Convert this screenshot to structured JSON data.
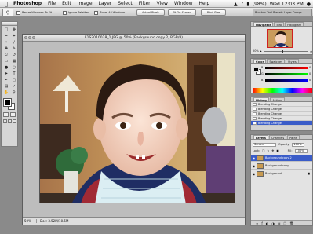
{
  "menubar": {
    "apple": "",
    "items": [
      "Photoshop",
      "File",
      "Edit",
      "Image",
      "Layer",
      "Select",
      "Filter",
      "View",
      "Window",
      "Help"
    ],
    "battery": "(98%)",
    "time": "Wed 12:03 PM",
    "battery_icon": "battery-icon",
    "volume_icon": "volume-icon",
    "search_icon": "spotlight-search-icon"
  },
  "options_bar": {
    "resize_windows": "Resize Windows To Fit",
    "ignore_palettes": "Ignore Palettes",
    "zoom_all": "Zoom All Windows",
    "actual_pixels": "Actual Pixels",
    "fit_on_screen": "Fit On Screen",
    "print_size": "Print Size",
    "palette_well": "Brushes  Tool Presets  Layer Comps"
  },
  "document": {
    "title": "F1S2010028_1.JPG @ 50% (Background copy 2, RGB/8)",
    "zoom": "50%",
    "doc_size": "Doc: 3.52M/10.5M"
  },
  "navigator": {
    "tabs": [
      "Navigator",
      "Info",
      "Histogram"
    ],
    "zoom": "50%"
  },
  "color_panel": {
    "tabs": [
      "Color",
      "Swatches",
      "Styles"
    ],
    "channels": [
      {
        "label": "R",
        "value": "0"
      },
      {
        "label": "G",
        "value": "0"
      },
      {
        "label": "B",
        "value": "0"
      }
    ]
  },
  "history": {
    "tabs": [
      "History",
      "Actions"
    ],
    "items": [
      "Blending Change",
      "Blending Change",
      "Blending Change",
      "Blending Change",
      "Blending Change"
    ],
    "selected_index": 4
  },
  "layers": {
    "tabs": [
      "Layers",
      "Channels",
      "Paths"
    ],
    "blend_mode": "Screen",
    "opacity_label": "Opacity:",
    "opacity": "100%",
    "lock_label": "Lock:",
    "fill_label": "Fill:",
    "fill": "100%",
    "items": [
      {
        "name": "Background copy 2",
        "selected": true
      },
      {
        "name": "Background copy",
        "selected": false
      },
      {
        "name": "Background",
        "selected": false
      }
    ]
  }
}
